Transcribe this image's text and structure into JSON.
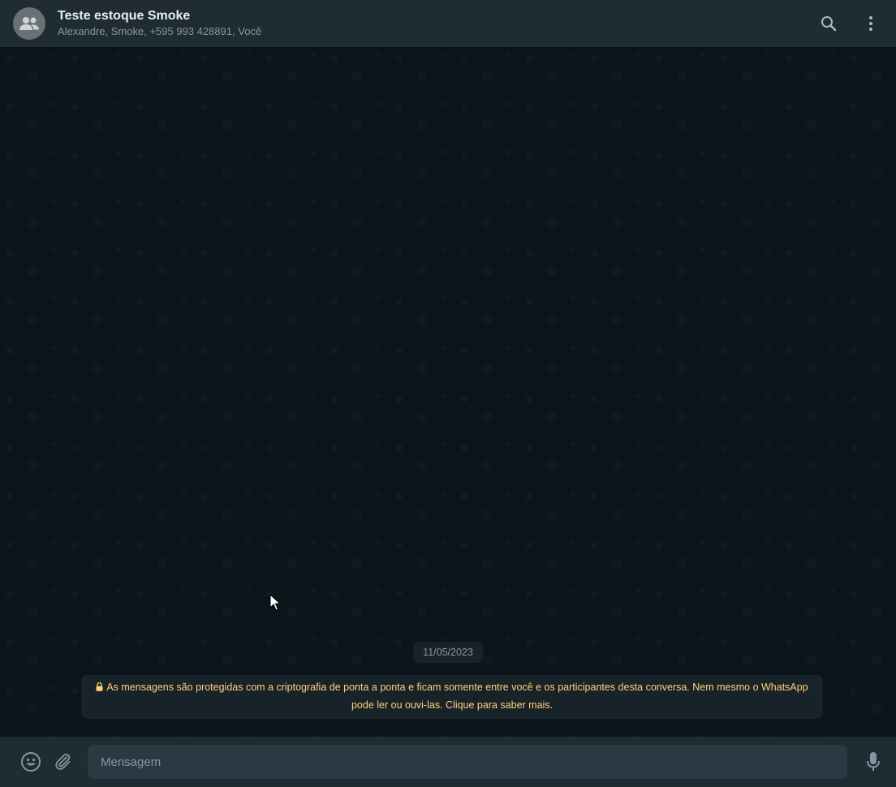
{
  "header": {
    "title": "Teste estoque Smoke",
    "participants": "Alexandre, Smoke, +595 993 428891, Você",
    "avatar_icon": "group-icon",
    "search_icon": "search-icon",
    "menu_icon": "menu-dots-icon"
  },
  "chat": {
    "date": "11/05/2023",
    "encryption_notice": "As mensagens são protegidas com a criptografia de ponta a ponta e ficam somente entre você e os participantes desta conversa. Nem mesmo o WhatsApp pode ler ou ouvi-las. Clique para saber mais.",
    "notice_color": "#ffd279"
  },
  "composer": {
    "placeholder": "Mensagem",
    "value": "",
    "emoji_icon": "emoji-icon",
    "attach_icon": "paperclip-icon",
    "mic_icon": "microphone-icon"
  },
  "colors": {
    "header_bg": "#202c33",
    "chat_bg": "#0b141a",
    "input_bg": "#2a3942"
  }
}
